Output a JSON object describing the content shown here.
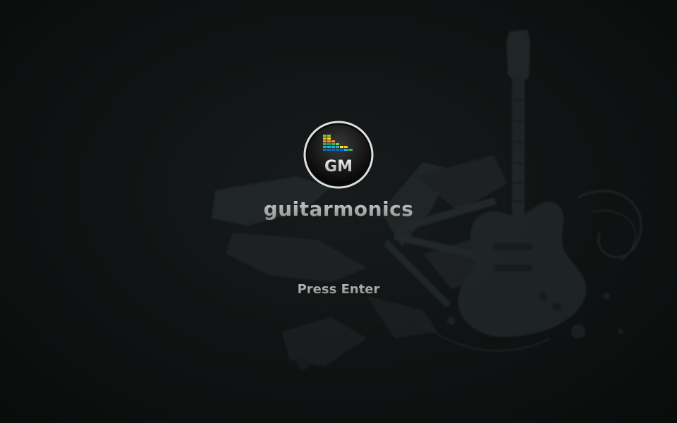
{
  "app": {
    "title": "guitarmonics",
    "logo_text": "GM",
    "prompt": "Press Enter"
  },
  "colors": {
    "background": "#0c0f0f",
    "title_text": "#b5b5b5",
    "prompt_text": "#9a9a9a",
    "badge_ring": "#d9d9d9",
    "badge_fill": "#1a1a1a"
  },
  "icons": {
    "logo": "equalizer-bars-icon",
    "background_art": "guitar-silhouette"
  }
}
